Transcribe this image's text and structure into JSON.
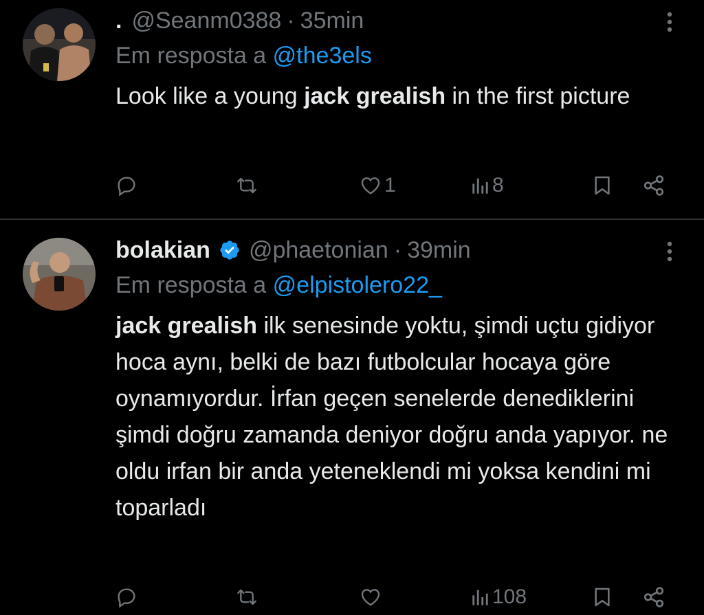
{
  "tweets": [
    {
      "display_name": ".",
      "handle": "@Seanm0388",
      "separator": "·",
      "time": "35min",
      "reply_prefix": "Em resposta a",
      "reply_to": "@the3els",
      "text_before": "Look like a young ",
      "text_bold": "jack grealish",
      "text_after": " in the first picture",
      "verified": false,
      "reply_count": "",
      "retweet_count": "",
      "like_count": "1",
      "view_count": "8"
    },
    {
      "display_name": "bolakian",
      "handle": "@phaetonian",
      "separator": "·",
      "time": "39min",
      "reply_prefix": "Em resposta a",
      "reply_to": "@elpistolero22_",
      "text_before": "",
      "text_bold": "jack grealish",
      "text_after": " ilk senesinde yoktu, şimdi uçtu gidiyor hoca aynı, belki de bazı futbolcular hocaya göre oynamıyordur. İrfan geçen senelerde denediklerini şimdi doğru zamanda deniyor doğru anda yapıyor. ne oldu irfan bir anda yeteneklendi mi yoksa kendini mi toparladı",
      "verified": true,
      "reply_count": "",
      "retweet_count": "",
      "like_count": "",
      "view_count": "108"
    }
  ],
  "icons": {
    "more": "more-vertical-icon",
    "reply": "reply-icon",
    "retweet": "retweet-icon",
    "like": "heart-icon",
    "views": "views-icon",
    "bookmark": "bookmark-icon",
    "share": "share-icon",
    "verified": "verified-badge-icon"
  },
  "colors": {
    "background": "#000000",
    "text": "#e7e9ea",
    "secondary": "#71767b",
    "link": "#1d9bf0",
    "divider": "#2f3336"
  }
}
